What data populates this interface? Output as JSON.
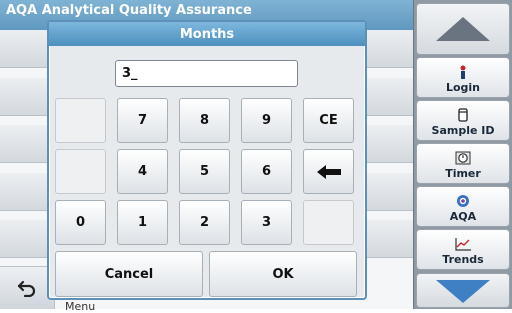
{
  "app": {
    "header_title": "AQA   Analytical Quality Assurance",
    "menu_label": "Menu"
  },
  "dialog": {
    "title": "Months",
    "entry_value": "3_"
  },
  "keypad": {
    "k7": "7",
    "k8": "8",
    "k9": "9",
    "ce": "CE",
    "k4": "4",
    "k5": "5",
    "k6": "6",
    "k0": "0",
    "k1": "1",
    "k2": "2",
    "k3": "3",
    "backspace_icon": "left-arrow-icon"
  },
  "actions": {
    "cancel": "Cancel",
    "ok": "OK"
  },
  "sidebar": {
    "scroll_up_icon": "triangle-up-icon",
    "scroll_down_icon": "triangle-down-icon",
    "items": [
      {
        "label": "Login",
        "icon": "person-icon"
      },
      {
        "label": "Sample ID",
        "icon": "sample-vial-icon"
      },
      {
        "label": "Timer",
        "icon": "timer-icon"
      },
      {
        "label": "AQA",
        "icon": "aqa-icon"
      },
      {
        "label": "Trends",
        "icon": "trend-chart-icon"
      }
    ]
  },
  "colors": {
    "title_bar": "#4d8fbd",
    "sidebar_bg": "#8f9aa5",
    "scroll_arrow": "#6a7480",
    "scroll_arrow_down": "#3f7fc4"
  }
}
